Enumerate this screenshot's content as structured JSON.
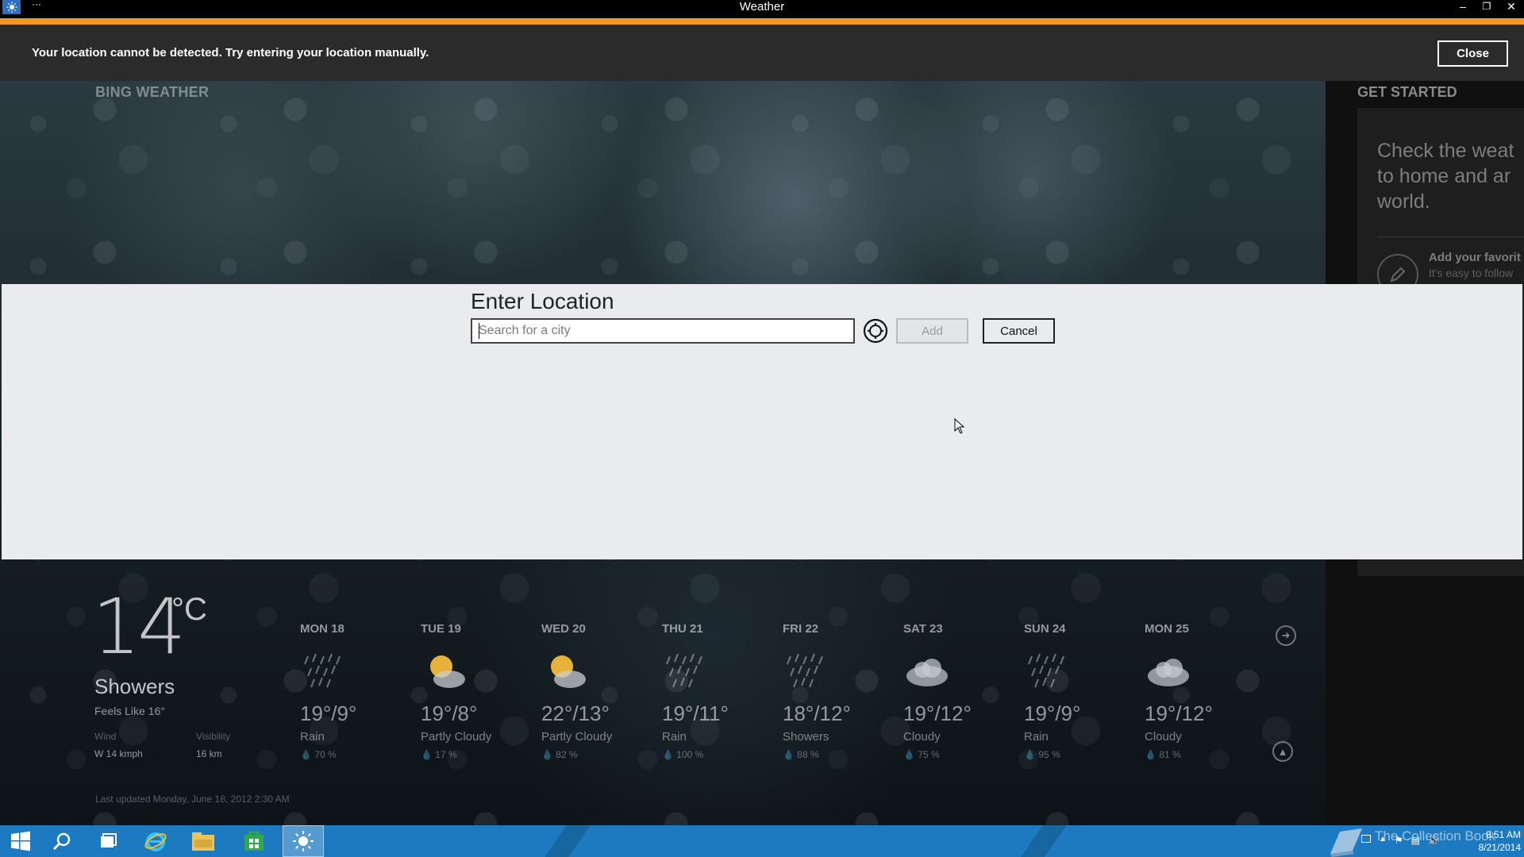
{
  "window": {
    "title": "Weather",
    "dots": "···",
    "minimize": "–",
    "restore": "❐",
    "close": "✕"
  },
  "notice": {
    "message": "Your location cannot be detected. Try entering your location manually.",
    "close_label": "Close"
  },
  "brand": "BING WEATHER",
  "get_started": {
    "heading": "GET STARTED",
    "text": "Check the weat\nto home and ar\nworld.",
    "fav_title": "Add your favorit",
    "fav_sub": "It's easy to follow"
  },
  "dialog": {
    "title": "Enter Location",
    "placeholder": "Search for a city",
    "add_label": "Add",
    "cancel_label": "Cancel"
  },
  "current": {
    "temp": "14",
    "unit": "°C",
    "condition": "Showers",
    "feels_like": "Feels Like 16°",
    "wind_label": "Wind",
    "wind_value": "W 14 kmph",
    "visibility_label": "Visibility",
    "visibility_value": "16 km",
    "last_updated": "Last updated Monday, June 18, 2012 2:30 AM"
  },
  "forecast": [
    {
      "day": "MON 18",
      "temps": "19°/9°",
      "condition": "Rain",
      "precip": "70 %",
      "icon": "rain-icon"
    },
    {
      "day": "TUE 19",
      "temps": "19°/8°",
      "condition": "Partly Cloudy",
      "precip": "17 %",
      "icon": "partly-cloudy-icon"
    },
    {
      "day": "WED 20",
      "temps": "22°/13°",
      "condition": "Partly Cloudy",
      "precip": "82 %",
      "icon": "partly-cloudy-icon"
    },
    {
      "day": "THU 21",
      "temps": "19°/11°",
      "condition": "Rain",
      "precip": "100 %",
      "icon": "rain-icon"
    },
    {
      "day": "FRI 22",
      "temps": "18°/12°",
      "condition": "Showers",
      "precip": "88 %",
      "icon": "rain-icon"
    },
    {
      "day": "SAT 23",
      "temps": "19°/12°",
      "condition": "Cloudy",
      "precip": "75 %",
      "icon": "cloud-icon"
    },
    {
      "day": "SUN 24",
      "temps": "19°/9°",
      "condition": "Rain",
      "precip": "95 %",
      "icon": "rain-icon"
    },
    {
      "day": "MON 25",
      "temps": "19°/12°",
      "condition": "Cloudy",
      "precip": "81 %",
      "icon": "cloud-icon"
    }
  ],
  "taskbar": {
    "clock_time": "8:51 AM",
    "clock_date": "8/21/2014",
    "watermark": "The Collection Book"
  },
  "colors": {
    "accent": "#f39a1e",
    "taskbar": "#1e7ac0",
    "dialog_bg": "#e9ebee"
  }
}
